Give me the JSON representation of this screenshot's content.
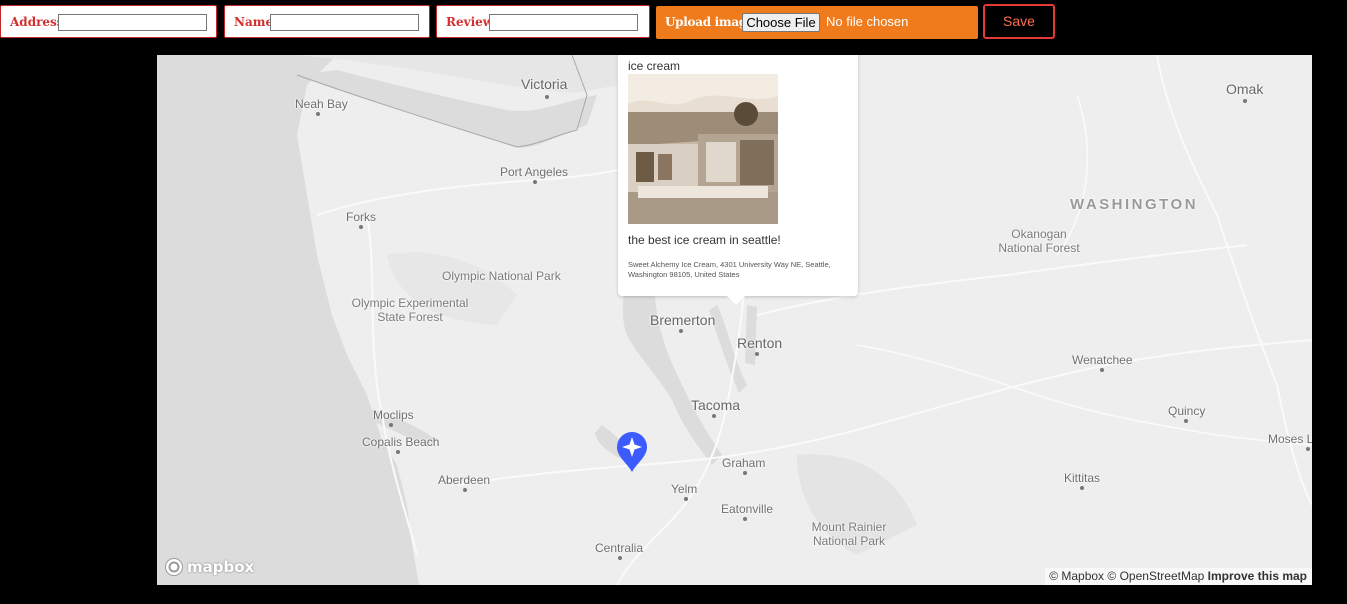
{
  "form": {
    "address_label": "Address",
    "address_value": "",
    "name_label": "Name",
    "name_value": "",
    "review_label": "Review",
    "review_value": "",
    "upload_label": "Upload image",
    "choose_file_label": "Choose File",
    "no_file_text": "No file chosen",
    "save_label": "Save"
  },
  "colors": {
    "field_border": "#c62828",
    "label_red": "#d32f2f",
    "upload_orange": "#f07b1d",
    "save_border": "#e53935",
    "marker_blue": "#3b5bff"
  },
  "map": {
    "places": [
      "Victoria",
      "Neah Bay",
      "Port Angeles",
      "Forks",
      "Olympic National Park",
      "Olympic Experimental State Forest",
      "Bremerton",
      "Renton",
      "Tacoma",
      "Moclips",
      "Copalis Beach",
      "Aberdeen",
      "Graham",
      "Yelm",
      "Eatonville",
      "Centralia",
      "Mount Rainier National Park",
      "Omak",
      "WASHINGTON",
      "Okanogan National Forest",
      "Wenatchee",
      "Quincy",
      "Moses Lake",
      "Kittitas"
    ],
    "popup": {
      "title": "ice cream",
      "review": "the best ice cream in seattle!",
      "address": "Sweet Alchemy Ice Cream, 4301 University Way NE, Seattle, Washington 98105, United States"
    },
    "marker_icon": "map-pin-icon",
    "logo_text": "mapbox",
    "attribution": {
      "mapbox": "© Mapbox",
      "osm": "© OpenStreetMap",
      "improve": "Improve this map"
    }
  }
}
